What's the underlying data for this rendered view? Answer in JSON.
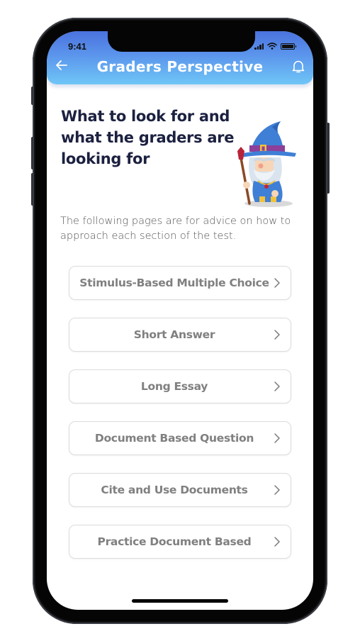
{
  "status_bar": {
    "time": "9:41",
    "icons": [
      "signal-icon",
      "wifi-icon",
      "battery-icon"
    ]
  },
  "header": {
    "title": "Graders Perspective",
    "back_icon": "arrow-left-icon",
    "notification_icon": "bell-icon",
    "gradient": [
      "#4a72de",
      "#6fc6f7"
    ]
  },
  "hero": {
    "title": "What to look for and what the graders are looking for",
    "illustration": "wizard-illustration"
  },
  "intro": {
    "text": "The following pages are for advice on how to approach each section of the test."
  },
  "menu": {
    "items": [
      {
        "label": "Stimulus-Based Multiple Choice",
        "icon": "chevron-right-icon"
      },
      {
        "label": "Short Answer",
        "icon": "chevron-right-icon"
      },
      {
        "label": "Long Essay",
        "icon": "chevron-right-icon"
      },
      {
        "label": "Document Based Question",
        "icon": "chevron-right-icon"
      },
      {
        "label": "Cite and Use Documents",
        "icon": "chevron-right-icon"
      },
      {
        "label": "Practice Document Based",
        "icon": "chevron-right-icon"
      }
    ]
  },
  "colors": {
    "title_text": "#1c2140",
    "menu_text": "#808080",
    "menu_border": "#dcdcdc",
    "body_text": "#555555"
  }
}
